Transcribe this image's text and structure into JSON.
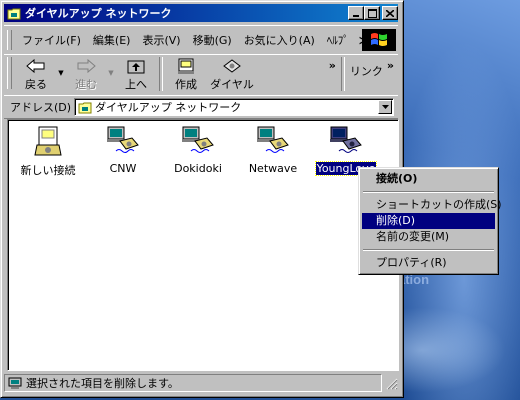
{
  "window": {
    "title": "ダイヤルアップ ネットワーク"
  },
  "menubar": {
    "items": [
      "ファイル(F)",
      "編集(E)",
      "表示(V)",
      "移動(G)",
      "お気に入り(A)",
      "ﾍﾙﾌﾟ"
    ],
    "more": "≫"
  },
  "toolbar": {
    "back": "戻る",
    "forward": "進む",
    "up": "上へ",
    "create": "作成",
    "dial": "ダイヤル",
    "more": "»",
    "links": "リンク",
    "links_more": "»"
  },
  "address": {
    "label": "アドレス(D)",
    "value": "ダイヤルアップ ネットワーク"
  },
  "files": [
    {
      "name": "新しい接続",
      "icon": "new-connection-icon"
    },
    {
      "name": "CNW",
      "icon": "dialup-connection-icon"
    },
    {
      "name": "Dokidoki",
      "icon": "dialup-connection-icon"
    },
    {
      "name": "Netwave",
      "icon": "dialup-connection-icon"
    },
    {
      "name": "YoungLove",
      "icon": "dialup-connection-icon",
      "selected": true
    }
  ],
  "context_menu": {
    "connect": "接続(O)",
    "shortcut": "ショートカットの作成(S)",
    "delete": "削除(D)",
    "rename": "名前の変更(M)",
    "properties": "プロパティ(R)"
  },
  "status": {
    "text": "選択された項目を削除します。"
  },
  "desktop": {
    "text": "ation"
  },
  "colors": {
    "titlebar_start": "#000080",
    "titlebar_end": "#1084d0",
    "face": "#c0c0c0",
    "highlight": "#000080"
  }
}
